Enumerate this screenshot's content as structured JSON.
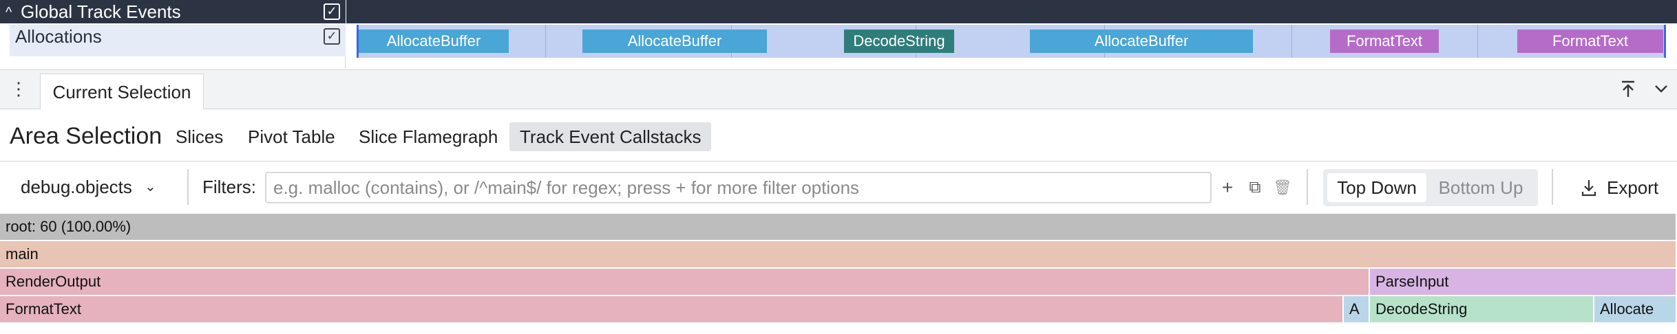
{
  "tracks": {
    "global_title": "Global Track Events",
    "allocations_title": "Allocations",
    "check_mark": "✓",
    "chevron": "^",
    "slices": [
      {
        "name": "AllocateBuffer",
        "kind": "alloc"
      },
      {
        "name": "AllocateBuffer",
        "kind": "alloc"
      },
      {
        "name": "DecodeString",
        "kind": "decode"
      },
      {
        "name": "AllocateBuffer",
        "kind": "alloc"
      },
      {
        "name": "FormatText",
        "kind": "format"
      },
      {
        "name": "FormatText",
        "kind": "format"
      }
    ]
  },
  "panel": {
    "menu_icon": "⋮",
    "tab_label": "Current Selection"
  },
  "area": {
    "title": "Area Selection",
    "tabs": [
      "Slices",
      "Pivot Table",
      "Slice Flamegraph",
      "Track Event Callstacks"
    ],
    "active_tab": "Track Event Callstacks"
  },
  "toolbar": {
    "metric": "debug.objects",
    "metric_chevron": "⌄",
    "filters_label": "Filters:",
    "filter_placeholder": "e.g. malloc (contains), or /^main$/ for regex; press + for more filter options",
    "add_icon": "+",
    "copy_icon": "⧉",
    "delete_icon": "🗑",
    "top_down": "Top Down",
    "bottom_up": "Bottom Up",
    "active_view": "Top Down",
    "export": "Export"
  },
  "flamegraph": {
    "rows": [
      [
        {
          "name": "root: 60 (100.00%)",
          "color": "#bdbdbd"
        }
      ],
      [
        {
          "name": "main",
          "color": "#e8c4b4"
        }
      ],
      [
        {
          "name": "RenderOutput",
          "color": "#e5b2bd"
        },
        {
          "name": "ParseInput",
          "color": "#d7b4e3"
        }
      ],
      [
        {
          "name": "FormatText",
          "color": "#e5b2bd"
        },
        {
          "name": "A",
          "color": "#b9d6e8"
        },
        {
          "name": "DecodeString",
          "color": "#b7e2ca"
        },
        {
          "name": "Allocate",
          "color": "#b9d6e8"
        }
      ]
    ]
  }
}
